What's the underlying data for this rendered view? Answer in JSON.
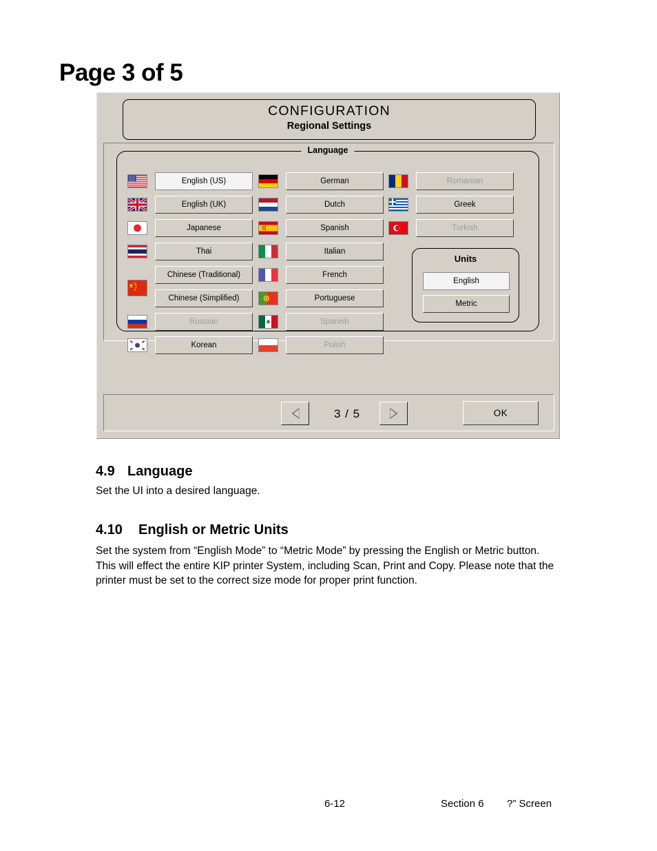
{
  "document": {
    "page_title": "Page 3 of 5",
    "sections": [
      {
        "number": "4.9",
        "heading": "Language",
        "body": "Set the UI into a desired language."
      },
      {
        "number": "4.10",
        "heading": "English or Metric Units",
        "body": "Set the system from “English Mode” to “Metric Mode” by pressing the English or Metric button. This will effect the entire KIP printer System, including Scan, Print and Copy. Please note that the printer must be set to the correct size mode for proper print function."
      }
    ],
    "footer": {
      "page_number": "6-12",
      "section": "Section 6",
      "screen": "?” Screen"
    }
  },
  "dialog": {
    "header": {
      "title": "CONFIGURATION",
      "subtitle": "Regional Settings"
    },
    "language_group": {
      "label": "Language",
      "columns": [
        {
          "items": [
            {
              "label": "English (US)",
              "flag": "flag-us",
              "state": "selected"
            },
            {
              "label": "English (UK)",
              "flag": "flag-uk",
              "state": "enabled"
            },
            {
              "label": "Japanese",
              "flag": "flag-jp",
              "state": "enabled"
            },
            {
              "label": "Thai",
              "flag": "flag-th",
              "state": "enabled"
            },
            {
              "label": "Chinese (Traditional)",
              "flag": "flag-cn",
              "state": "enabled"
            },
            {
              "label": "Chinese (Simplified)",
              "flag": "",
              "state": "enabled"
            },
            {
              "label": "Russian",
              "flag": "flag-ru",
              "state": "disabled"
            },
            {
              "label": "Korean",
              "flag": "flag-kr",
              "state": "enabled"
            }
          ]
        },
        {
          "items": [
            {
              "label": "German",
              "flag": "flag-de",
              "state": "enabled"
            },
            {
              "label": "Dutch",
              "flag": "flag-nl",
              "state": "enabled"
            },
            {
              "label": "Spanish",
              "flag": "flag-es",
              "state": "enabled"
            },
            {
              "label": "Italian",
              "flag": "flag-it",
              "state": "enabled"
            },
            {
              "label": "French",
              "flag": "flag-fr",
              "state": "enabled"
            },
            {
              "label": "Portuguese",
              "flag": "flag-pt",
              "state": "enabled"
            },
            {
              "label": "Spanish",
              "flag": "flag-mx",
              "state": "disabled"
            },
            {
              "label": "Polish",
              "flag": "flag-pl",
              "state": "disabled"
            }
          ]
        },
        {
          "items": [
            {
              "label": "Romanian",
              "flag": "flag-ro",
              "state": "disabled"
            },
            {
              "label": "Greek",
              "flag": "flag-gr",
              "state": "enabled"
            },
            {
              "label": "Turkish",
              "flag": "flag-tr",
              "state": "disabled"
            }
          ]
        }
      ]
    },
    "units_group": {
      "label": "Units",
      "options": [
        {
          "label": "English",
          "state": "selected"
        },
        {
          "label": "Metric",
          "state": "enabled"
        }
      ]
    },
    "footer_bar": {
      "prev_icon": "triangle-left-icon",
      "next_icon": "triangle-right-icon",
      "page_indicator": "3 / 5",
      "ok_label": "OK"
    }
  },
  "colors": {
    "dialog_face": "#d4d0c8",
    "disabled_text": "#9b9b9b",
    "selected_fill": "#e8e8e8"
  }
}
